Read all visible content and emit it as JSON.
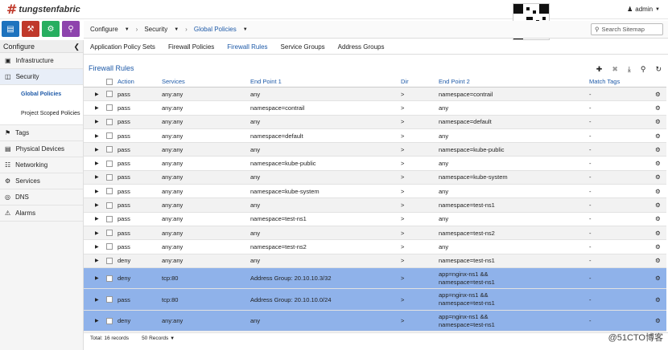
{
  "brand": {
    "logo": "tungstenfabric"
  },
  "user": {
    "name": "admin"
  },
  "nav_icons": [
    {
      "name": "monitor",
      "color": "#1e73be"
    },
    {
      "name": "configure",
      "color": "#c0392b"
    },
    {
      "name": "settings",
      "color": "#27ae60"
    },
    {
      "name": "query",
      "color": "#8e44ad"
    }
  ],
  "sidebar": {
    "title": "Configure",
    "items": [
      {
        "label": "Infrastructure",
        "icon": "monitor-icon"
      },
      {
        "label": "Security",
        "icon": "shield-icon"
      },
      {
        "label": "Global Policies",
        "sub": true,
        "active": true
      },
      {
        "label": "Project Scoped Policies",
        "sub": true
      },
      {
        "label": "Tags",
        "icon": "tag-icon"
      },
      {
        "label": "Physical Devices",
        "icon": "server-icon"
      },
      {
        "label": "Networking",
        "icon": "network-icon"
      },
      {
        "label": "Services",
        "icon": "services-icon"
      },
      {
        "label": "DNS",
        "icon": "globe-icon"
      },
      {
        "label": "Alarms",
        "icon": "bell-icon"
      }
    ]
  },
  "breadcrumb": [
    "Configure",
    "Security",
    "Global Policies"
  ],
  "search": {
    "placeholder": "Search Sitemap"
  },
  "tabs": [
    "Application Policy Sets",
    "Firewall Policies",
    "Firewall Rules",
    "Service Groups",
    "Address Groups"
  ],
  "active_tab": "Firewall Rules",
  "grid": {
    "title": "Firewall Rules",
    "columns": [
      "Action",
      "Services",
      "End Point 1",
      "Dir",
      "End Point 2",
      "Match Tags"
    ],
    "rows": [
      [
        "pass",
        "any:any",
        "any",
        ">",
        "namespace=contrail",
        "-"
      ],
      [
        "pass",
        "any:any",
        "namespace=contrail",
        ">",
        "any",
        "-"
      ],
      [
        "pass",
        "any:any",
        "any",
        ">",
        "namespace=default",
        "-"
      ],
      [
        "pass",
        "any:any",
        "namespace=default",
        ">",
        "any",
        "-"
      ],
      [
        "pass",
        "any:any",
        "any",
        ">",
        "namespace=kube-public",
        "-"
      ],
      [
        "pass",
        "any:any",
        "namespace=kube-public",
        ">",
        "any",
        "-"
      ],
      [
        "pass",
        "any:any",
        "any",
        ">",
        "namespace=kube-system",
        "-"
      ],
      [
        "pass",
        "any:any",
        "namespace=kube-system",
        ">",
        "any",
        "-"
      ],
      [
        "pass",
        "any:any",
        "any",
        ">",
        "namespace=test-ns1",
        "-"
      ],
      [
        "pass",
        "any:any",
        "namespace=test-ns1",
        ">",
        "any",
        "-"
      ],
      [
        "pass",
        "any:any",
        "any",
        ">",
        "namespace=test-ns2",
        "-"
      ],
      [
        "pass",
        "any:any",
        "namespace=test-ns2",
        ">",
        "any",
        "-"
      ],
      [
        "deny",
        "any:any",
        "any",
        ">",
        "namespace=test-ns1",
        "-"
      ],
      [
        "deny",
        "tcp:80",
        "Address Group: 20.10.10.3/32",
        ">",
        "app=nginx-ns1 && namespace=test-ns1",
        "-"
      ],
      [
        "pass",
        "tcp:80",
        "Address Group: 20.10.10.0/24",
        ">",
        "app=nginx-ns1 && namespace=test-ns1",
        "-"
      ],
      [
        "deny",
        "any:any",
        "any",
        ">",
        "app=nginx-ns1 && namespace=test-ns1",
        "-"
      ]
    ],
    "selected_from": 13
  },
  "footer": {
    "total": "Total: 16 records",
    "page_size": "50 Records"
  },
  "watermark": "@51CTO博客"
}
